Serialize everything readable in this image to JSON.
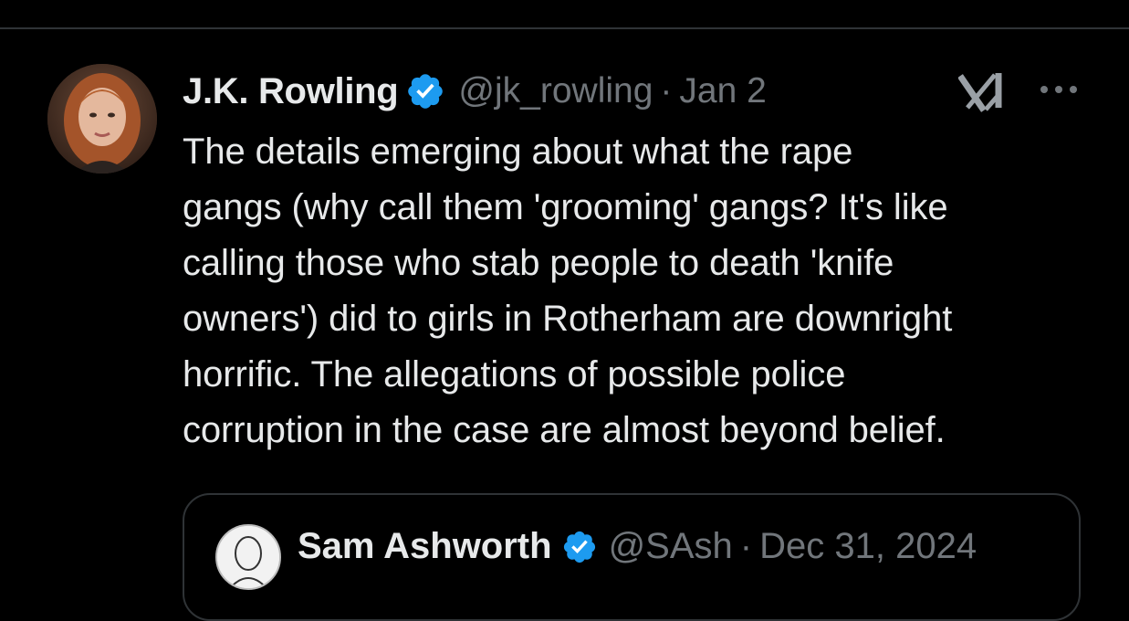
{
  "tweet": {
    "display_name": "J.K. Rowling",
    "handle": "@jk_rowling",
    "separator": "·",
    "date": "Jan 2",
    "text": "The details emerging about what the rape\ngangs (why call them 'grooming' gangs? It's like\ncalling those who stab people to death 'knife\nowners') did to girls in Rotherham are downright\nhorrific. The allegations of possible police\ncorruption in the case are almost beyond belief.",
    "icons": {
      "avatar": "profile-photo",
      "verified": "verified-badge-icon",
      "grok": "grok-icon",
      "more": "more-options-icon"
    }
  },
  "quoted": {
    "display_name": "Sam Ashworth",
    "handle": "@SAsh",
    "separator": "·",
    "date": "Dec 31, 2024"
  },
  "colors": {
    "background": "#000000",
    "text_primary": "#e7e9ea",
    "text_secondary": "#71767b",
    "verified_blue": "#1d9bf0",
    "border": "#2f3336"
  }
}
